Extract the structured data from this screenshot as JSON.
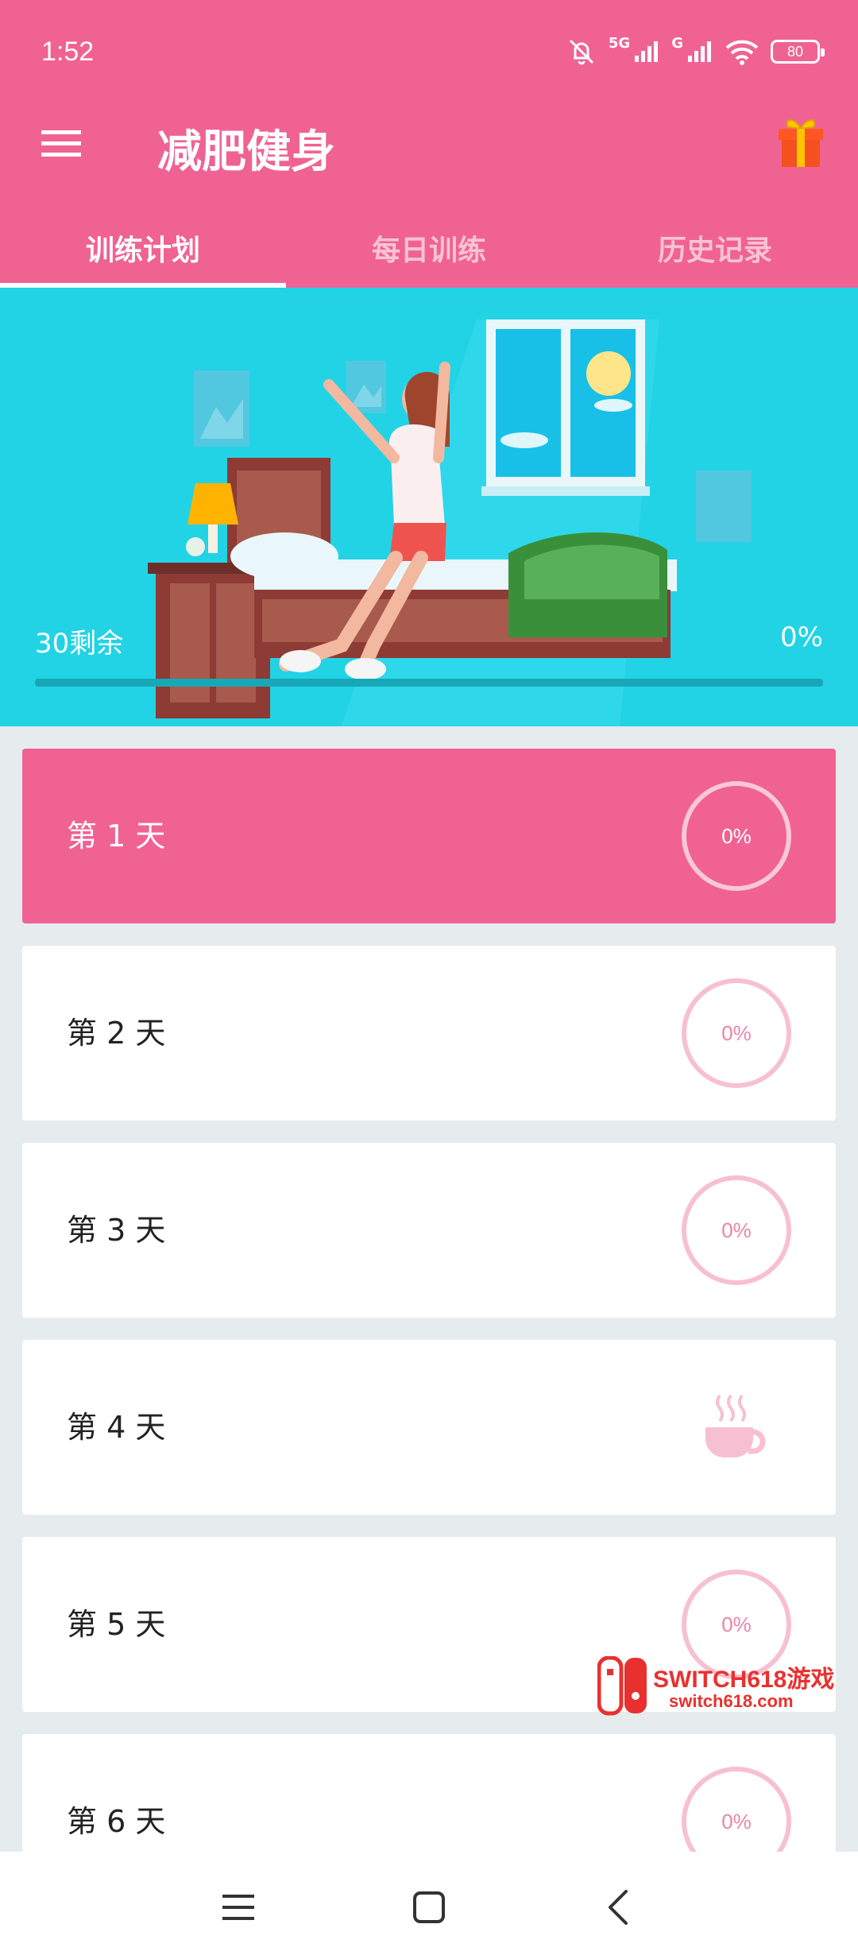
{
  "status_bar": {
    "time": "1:52",
    "network1": "5G",
    "network2": "G",
    "battery": "80",
    "icons": [
      "mute-icon",
      "signal-icon",
      "signal-icon",
      "wifi-icon",
      "battery-icon"
    ]
  },
  "toolbar": {
    "title": "减肥健身",
    "menu_icon": "menu-icon",
    "gift_icon": "gift-icon"
  },
  "tabs": [
    {
      "label": "训练计划",
      "active": true
    },
    {
      "label": "每日训练",
      "active": false
    },
    {
      "label": "历史记录",
      "active": false
    }
  ],
  "hero": {
    "remaining_text": "30剩余",
    "percent_text": "0%",
    "progress": 0
  },
  "days": [
    {
      "label": "第 1 天",
      "progress": "0%",
      "type": "ring",
      "active": true
    },
    {
      "label": "第 2 天",
      "progress": "0%",
      "type": "ring",
      "active": false
    },
    {
      "label": "第 3 天",
      "progress": "0%",
      "type": "ring",
      "active": false
    },
    {
      "label": "第 4 天",
      "progress": "",
      "type": "rest",
      "icon": "coffee-cup-icon",
      "active": false
    },
    {
      "label": "第 5 天",
      "progress": "0%",
      "type": "ring",
      "active": false
    },
    {
      "label": "第 6 天",
      "progress": "0%",
      "type": "ring",
      "active": false
    }
  ],
  "watermark": {
    "line1": "SWITCH618游戏",
    "line2": "switch618.com"
  },
  "colors": {
    "primary": "#f06292",
    "hero_bg": "#21d3e5",
    "list_bg": "#e6ebee",
    "ring": "#f7c0d2"
  }
}
